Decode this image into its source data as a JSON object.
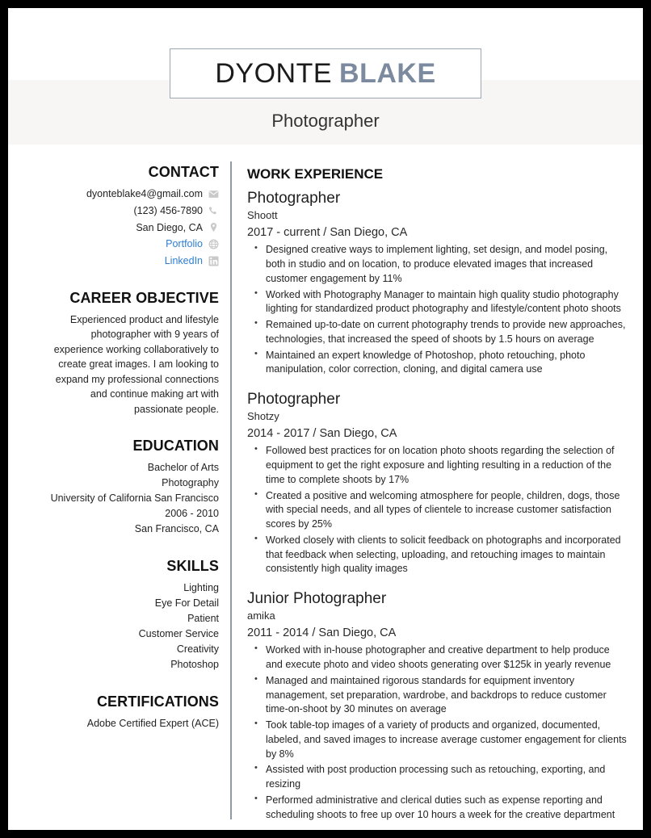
{
  "header": {
    "name_first": "DYONTE",
    "name_last": "BLAKE",
    "job_title": "Photographer",
    "accent_color": "#7b8a9e",
    "link_color": "#2e7fd4",
    "band_color": "#f7f6f5"
  },
  "sidebar": {
    "contact": {
      "heading": "CONTACT",
      "items": [
        {
          "text": "dyonteblake4@gmail.com",
          "icon": "envelope-icon",
          "is_link": false
        },
        {
          "text": "(123) 456-7890",
          "icon": "phone-icon",
          "is_link": false
        },
        {
          "text": "San Diego, CA",
          "icon": "location-pin-icon",
          "is_link": false
        },
        {
          "text": "Portfolio",
          "icon": "globe-icon",
          "is_link": true
        },
        {
          "text": "LinkedIn",
          "icon": "linkedin-icon",
          "is_link": true
        }
      ]
    },
    "objective": {
      "heading": "CAREER OBJECTIVE",
      "text": "Experienced product and lifestyle photographer with 9 years of experience working collaboratively to create great images. I am looking to expand my professional connections and continue making art with passionate people."
    },
    "education": {
      "heading": "EDUCATION",
      "lines": [
        "Bachelor of Arts",
        "Photography",
        "University of California San Francisco",
        "2006 - 2010",
        "San Francisco, CA"
      ]
    },
    "skills": {
      "heading": "SKILLS",
      "items": [
        "Lighting",
        "Eye For Detail",
        "Patient",
        "Customer Service",
        "Creativity",
        "Photoshop"
      ]
    },
    "certifications": {
      "heading": "CERTIFICATIONS",
      "items": [
        "Adobe Certified Expert (ACE)"
      ]
    }
  },
  "work": {
    "heading": "WORK EXPERIENCE",
    "jobs": [
      {
        "role": "Photographer",
        "company": "Shoott",
        "meta": "2017 - current  /  San Diego, CA",
        "bullets": [
          "Designed creative ways to implement lighting, set design, and model posing, both in studio and on location, to produce elevated images that increased customer engagement by 11%",
          "Worked with Photography Manager to maintain high quality studio photography lighting for standardized product photography and lifestyle/content photo shoots",
          "Remained up-to-date on current photography trends to provide new approaches, technologies, that increased the speed of shoots by 1.5 hours on average",
          "Maintained an expert knowledge of Photoshop, photo retouching, photo manipulation, color correction, cloning, and digital camera use"
        ]
      },
      {
        "role": "Photographer",
        "company": "Shotzy",
        "meta": "2014 - 2017  /  San Diego, CA",
        "bullets": [
          "Followed best practices for on location photo shoots regarding the selection of equipment to get the right exposure and lighting resulting in a reduction of the time to complete shoots by 17%",
          "Created a positive and welcoming atmosphere for people, children, dogs, those with special needs, and all types of clientele to increase customer satisfaction scores by 25%",
          "Worked closely with clients to solicit feedback on photographs and incorporated that feedback when selecting, uploading, and retouching images to maintain consistently high quality images"
        ]
      },
      {
        "role": "Junior Photographer",
        "company": "amika",
        "meta": "2011 - 2014  /  San Diego, CA",
        "bullets": [
          "Worked with in-house photographer and creative department to help produce and execute photo and video shoots generating over $125k in yearly revenue",
          "Managed and maintained rigorous standards for equipment inventory management, set preparation, wardrobe, and backdrops to reduce customer time-on-shoot by 30 minutes on average",
          "Took table-top images of a variety of products and organized, documented, labeled, and saved images to increase average customer engagement for clients by 8%",
          "Assisted with post production processing such as retouching, exporting, and resizing",
          "Performed administrative and clerical duties such as expense reporting and scheduling shoots to free up over 10 hours a week for the creative department"
        ]
      }
    ]
  }
}
